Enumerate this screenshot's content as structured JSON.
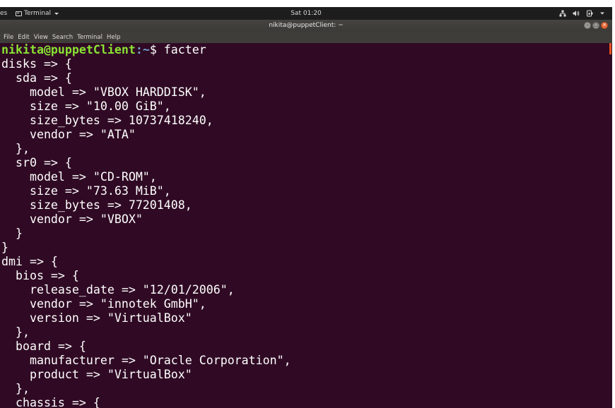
{
  "topbar": {
    "activities_label": "es",
    "app_menu_label": "Terminal",
    "clock": "Sat 01:20",
    "tray_icons": [
      "network-icon",
      "volume-icon",
      "power-icon",
      "chevron-down-icon"
    ]
  },
  "window": {
    "title": "nikita@puppetClient: ~",
    "buttons": [
      "minimize-icon",
      "maximize-icon",
      "close-icon"
    ]
  },
  "menubar": {
    "items": [
      "File",
      "Edit",
      "View",
      "Search",
      "Terminal",
      "Help"
    ]
  },
  "terminal": {
    "prompt": {
      "user_host": "nikita@puppetClient",
      "path": ":~",
      "symbol": "$ ",
      "command": "facter"
    },
    "lines": [
      "disks => {",
      "  sda => {",
      "    model => \"VBOX HARDDISK\",",
      "    size => \"10.00 GiB\",",
      "    size_bytes => 10737418240,",
      "    vendor => \"ATA\"",
      "  },",
      "  sr0 => {",
      "    model => \"CD-ROM\",",
      "    size => \"73.63 MiB\",",
      "    size_bytes => 77201408,",
      "    vendor => \"VBOX\"",
      "  }",
      "}",
      "dmi => {",
      "  bios => {",
      "    release_date => \"12/01/2006\",",
      "    vendor => \"innotek GmbH\",",
      "    version => \"VirtualBox\"",
      "  },",
      "  board => {",
      "    manufacturer => \"Oracle Corporation\",",
      "    product => \"VirtualBox\"",
      "  },",
      "  chassis => {"
    ]
  },
  "colors": {
    "terminal_bg": "#300a24",
    "prompt_user": "#8ae234",
    "prompt_path": "#729fcf",
    "accent": "#e95420"
  }
}
